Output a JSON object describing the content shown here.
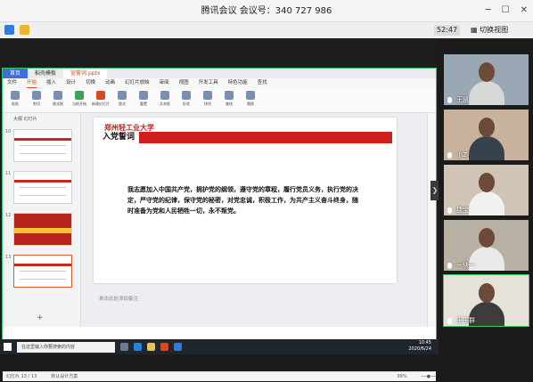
{
  "meeting": {
    "title": "腾讯会议 会议号：340 727 986",
    "timer": "52:47",
    "switch_view_label": "切换视图",
    "collapse_symbol": "❯"
  },
  "ppt": {
    "tabs": [
      {
        "label": "首页"
      },
      {
        "label": "稻壳模板"
      },
      {
        "label": "宣誓词.pptx"
      }
    ],
    "menu": [
      "文件",
      "开始",
      "插入",
      "设计",
      "切换",
      "动画",
      "幻灯片放映",
      "审阅",
      "视图",
      "开发工具",
      "特色功能",
      "查找"
    ],
    "active_menu": "开始",
    "ribbon_buttons": [
      {
        "label": "粘贴",
        "color": "blue"
      },
      {
        "label": "剪切",
        "color": "blue"
      },
      {
        "label": "格式刷",
        "color": "blue"
      },
      {
        "label": "当前开始",
        "color": "green"
      },
      {
        "label": "新建幻灯片",
        "color": "red"
      },
      {
        "label": "版式",
        "color": "blue"
      },
      {
        "label": "重置",
        "color": "blue"
      },
      {
        "label": "文本框",
        "color": "blue"
      },
      {
        "label": "形状",
        "color": "blue"
      },
      {
        "label": "排列",
        "color": "blue"
      },
      {
        "label": "查找",
        "color": "blue"
      },
      {
        "label": "替换",
        "color": "blue"
      }
    ],
    "thumbs_header": "大纲  幻灯片",
    "thumbnails": [
      {
        "num": "10",
        "style": "plain",
        "selected": false
      },
      {
        "num": "11",
        "style": "plain",
        "selected": false
      },
      {
        "num": "12",
        "style": "flag",
        "selected": false
      },
      {
        "num": "13",
        "style": "plain",
        "selected": true
      }
    ],
    "add_slide_symbol": "+",
    "slide": {
      "school": "郑州轻工业大学",
      "heading": "入党誓词",
      "oath": "我志愿加入中国共产党，拥护党的纲领，遵守党的章程，履行党员义务，执行党的决定，严守党的纪律，保守党的秘密，对党忠诚，积极工作，为共产主义奋斗终身，随时准备为党和人民牺牲一切，永不叛党。"
    },
    "notes_placeholder": "单击此处添加备注",
    "status": {
      "slide_count": "幻灯片 13 / 13",
      "theme": "默认设计方案",
      "zoom": "99%"
    }
  },
  "taskbar": {
    "search_placeholder": "在这里输入你要搜索的内容",
    "time": "10:45",
    "date": "2020/6/24"
  },
  "participants": [
    {
      "name": "王凯",
      "bg": "#9aa7b5",
      "shirt": "#d7d9d9",
      "active": false
    },
    {
      "name": "小Z",
      "bg": "#c9b39c",
      "shirt": "#38424f",
      "active": false
    },
    {
      "name": "捷宝",
      "bg": "#cfc4b6",
      "shirt": "#f1f1f1",
      "active": false
    },
    {
      "name": "一块一",
      "bg": "#b8b0a3",
      "shirt": "#e9e9e9",
      "active": false
    },
    {
      "name": "王玉群",
      "bg": "#e7e2d9",
      "shirt": "#3c3c3c",
      "active": true
    }
  ]
}
